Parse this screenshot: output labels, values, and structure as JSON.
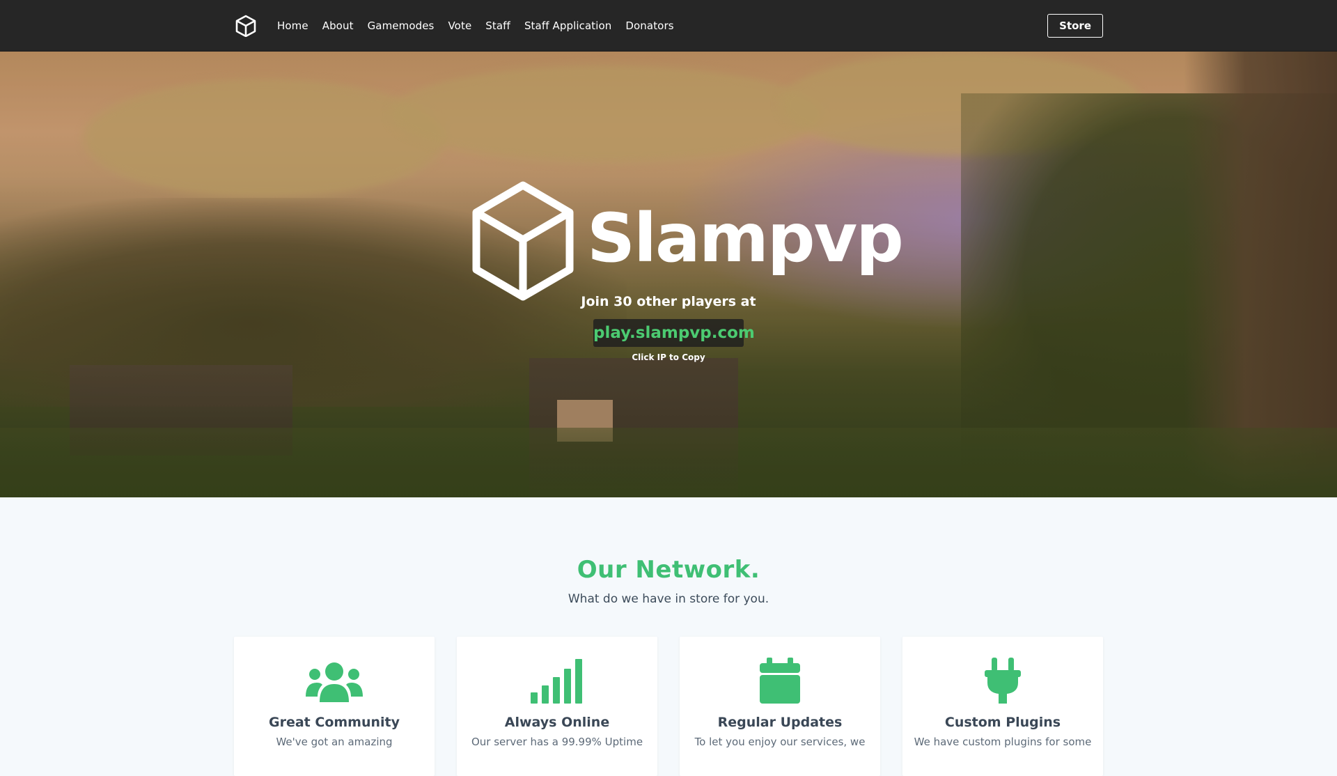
{
  "nav": {
    "logo_icon": "cube-icon",
    "links": [
      "Home",
      "About",
      "Gamemodes",
      "Vote",
      "Staff",
      "Staff Application",
      "Donators"
    ],
    "store_label": "Store"
  },
  "hero": {
    "logo_icon": "cube-icon",
    "title": "Slampvp",
    "subtitle": "Join 30 other players at",
    "ip": "play.slampvp.com",
    "hint": "Click IP to Copy"
  },
  "network": {
    "title": "Our Network.",
    "subtitle": "What do we have in store for you.",
    "accent_color": "#3fbf74",
    "cards": [
      {
        "icon": "users-icon",
        "title": "Great Community",
        "text": "We've got an amazing"
      },
      {
        "icon": "signal-icon",
        "title": "Always Online",
        "text": "Our server has a 99.99% Uptime"
      },
      {
        "icon": "calendar-icon",
        "title": "Regular Updates",
        "text": "To let you enjoy our services, we"
      },
      {
        "icon": "plug-icon",
        "title": "Custom Plugins",
        "text": "We have custom plugins for some"
      }
    ]
  }
}
